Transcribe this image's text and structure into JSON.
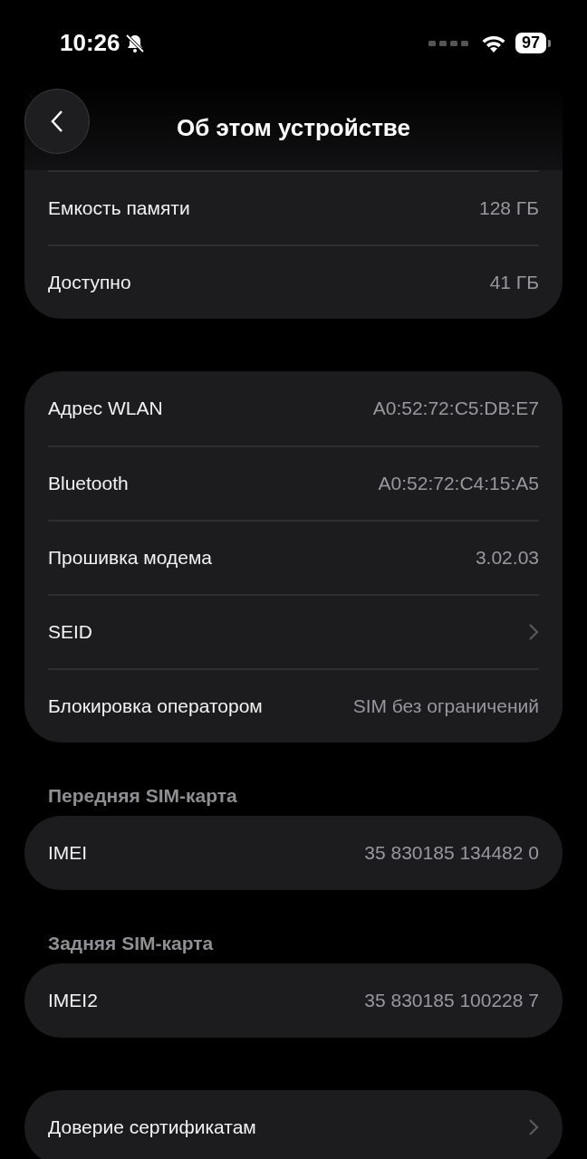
{
  "status_bar": {
    "time": "10:26",
    "silent": true,
    "battery": "97"
  },
  "header": {
    "title": "Об этом устройстве"
  },
  "groups": [
    {
      "rows": [
        {
          "kind": "value",
          "label": "Емкость памяти",
          "value": "128 ГБ"
        },
        {
          "kind": "value",
          "label": "Доступно",
          "value": "41 ГБ"
        }
      ]
    },
    {
      "rows": [
        {
          "kind": "value",
          "label": "Адрес WLAN",
          "value": "A0:52:72:C5:DB:E7"
        },
        {
          "kind": "value",
          "label": "Bluetooth",
          "value": "A0:52:72:C4:15:A5"
        },
        {
          "kind": "value",
          "label": "Прошивка модема",
          "value": "3.02.03"
        },
        {
          "kind": "link",
          "label": "SEID"
        },
        {
          "kind": "value",
          "label": "Блокировка оператором",
          "value": "SIM без ограничений"
        }
      ]
    },
    {
      "label": "Передняя SIM-карта",
      "rows": [
        {
          "kind": "value",
          "label": "IMEI",
          "value": "35 830185 134482 0"
        }
      ]
    },
    {
      "label": "Задняя SIM-карта",
      "rows": [
        {
          "kind": "value",
          "label": "IMEI2",
          "value": "35 830185 100228 7"
        }
      ]
    },
    {
      "rows": [
        {
          "kind": "link",
          "label": "Доверие сертификатам"
        }
      ]
    }
  ]
}
